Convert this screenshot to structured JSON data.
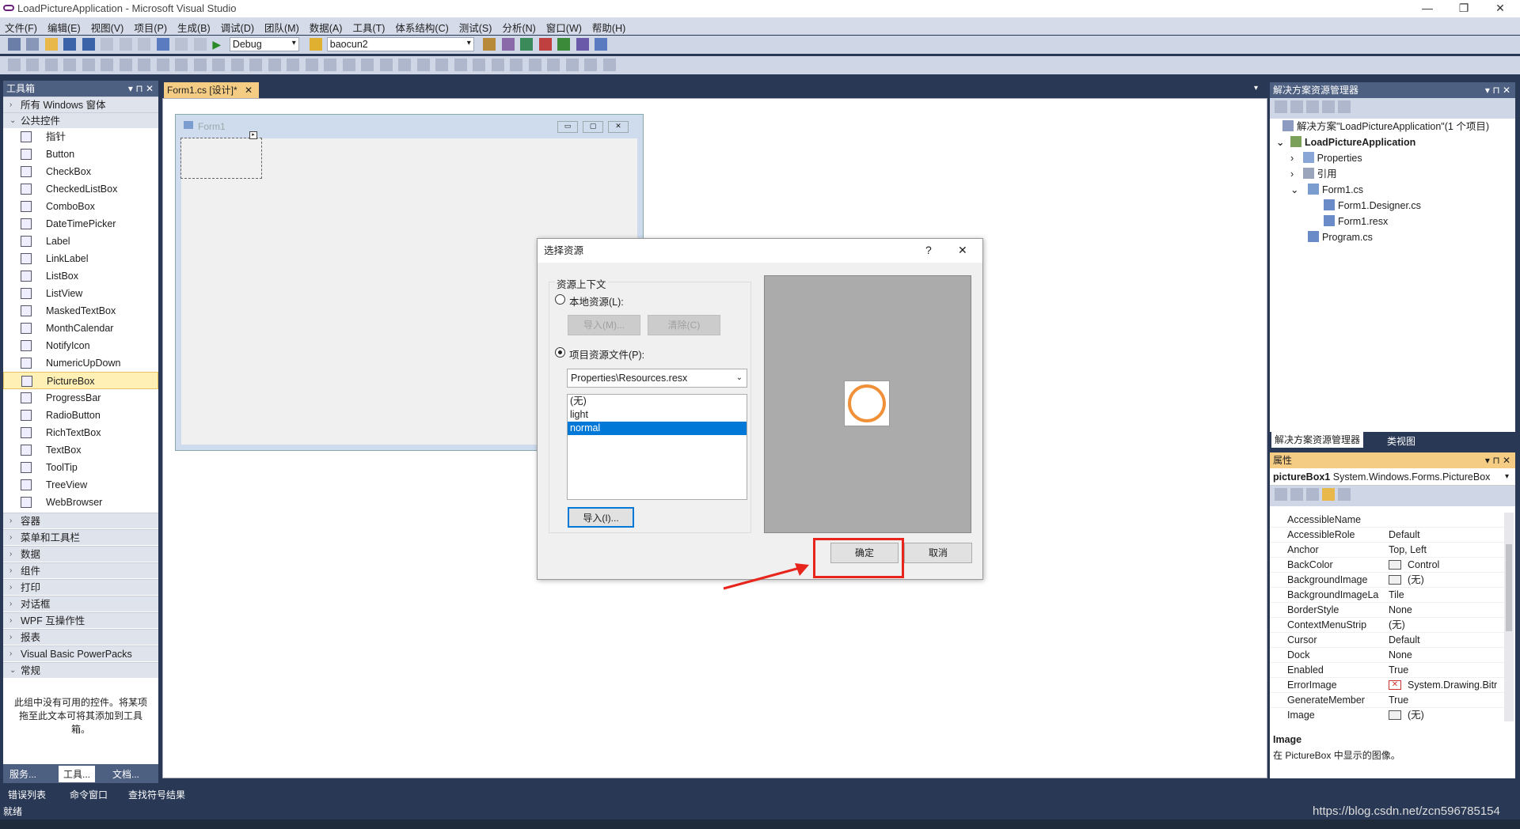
{
  "app": {
    "title": "LoadPictureApplication - Microsoft Visual Studio"
  },
  "menu": [
    "文件(F)",
    "编辑(E)",
    "视图(V)",
    "项目(P)",
    "生成(B)",
    "调试(D)",
    "团队(M)",
    "数据(A)",
    "工具(T)",
    "体系结构(C)",
    "测试(S)",
    "分析(N)",
    "窗口(W)",
    "帮助(H)"
  ],
  "toolbar": {
    "config": "Debug",
    "platform": "baocun2"
  },
  "toolbox": {
    "title": "工具箱",
    "groups_top": [
      "所有 Windows 窗体",
      "公共控件"
    ],
    "items": [
      "指针",
      "Button",
      "CheckBox",
      "CheckedListBox",
      "ComboBox",
      "DateTimePicker",
      "Label",
      "LinkLabel",
      "ListBox",
      "ListView",
      "MaskedTextBox",
      "MonthCalendar",
      "NotifyIcon",
      "NumericUpDown",
      "PictureBox",
      "ProgressBar",
      "RadioButton",
      "RichTextBox",
      "TextBox",
      "ToolTip",
      "TreeView",
      "WebBrowser"
    ],
    "selected": "PictureBox",
    "groups_bottom": [
      "容器",
      "菜单和工具栏",
      "数据",
      "组件",
      "打印",
      "对话框",
      "WPF 互操作性",
      "报表",
      "Visual Basic PowerPacks",
      "常规"
    ],
    "empty_msg": "此组中没有可用的控件。将某项拖至此文本可将其添加到工具箱。",
    "tabs": [
      "服务...",
      "工具...",
      "文档..."
    ]
  },
  "document": {
    "tab": "Form1.cs [设计]*",
    "form_title": "Form1"
  },
  "dialog": {
    "title": "选择资源",
    "help": "?",
    "close": "✕",
    "group": "资源上下文",
    "local": "本地资源(L):",
    "import_dis": "导入(M)...",
    "clear_dis": "清除(C)",
    "project": "项目资源文件(P):",
    "resx": "Properties\\Resources.resx",
    "list": [
      "(无)",
      "light",
      "normal"
    ],
    "selected": "normal",
    "import": "导入(I)...",
    "ok": "确定",
    "cancel": "取消"
  },
  "solution": {
    "title": "解决方案资源管理器",
    "root": "解决方案\"LoadPictureApplication\"(1 个项目)",
    "project": "LoadPictureApplication",
    "items": [
      "Properties",
      "引用",
      "Form1.cs",
      "Form1.Designer.cs",
      "Form1.resx",
      "Program.cs"
    ],
    "tabs": [
      "解决方案资源管理器",
      "类视图"
    ]
  },
  "properties": {
    "title": "属性",
    "object": "pictureBox1",
    "type": "System.Windows.Forms.PictureBox",
    "rows": [
      [
        "AccessibleName",
        ""
      ],
      [
        "AccessibleRole",
        "Default"
      ],
      [
        "Anchor",
        "Top, Left"
      ],
      [
        "BackColor",
        "Control"
      ],
      [
        "BackgroundImage",
        "(无)"
      ],
      [
        "BackgroundImageLa",
        "Tile"
      ],
      [
        "BorderStyle",
        "None"
      ],
      [
        "ContextMenuStrip",
        "(无)"
      ],
      [
        "Cursor",
        "Default"
      ],
      [
        "Dock",
        "None"
      ],
      [
        "Enabled",
        "True"
      ],
      [
        "ErrorImage",
        "System.Drawing.Bitr"
      ],
      [
        "GenerateMember",
        "True"
      ],
      [
        "Image",
        "(无)"
      ]
    ],
    "desc_title": "Image",
    "desc": "在 PictureBox 中显示的图像。"
  },
  "bottom": {
    "tabs": [
      "错误列表",
      "命令窗口",
      "查找符号结果"
    ],
    "status": "就绪",
    "watermark": "https://blog.csdn.net/zcn596785154"
  }
}
